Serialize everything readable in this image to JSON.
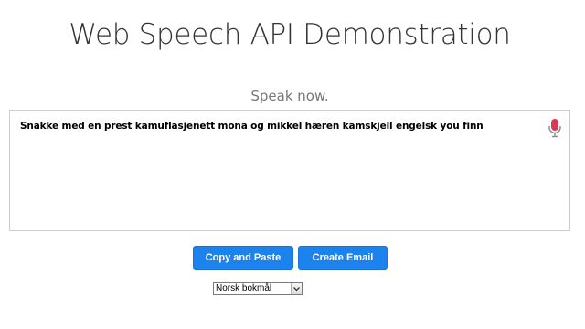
{
  "header": {
    "title_part1": "Web Speech API",
    "title_part2": "Demonstration"
  },
  "status": {
    "info_text": "Speak now."
  },
  "results": {
    "transcript": "Snakke med en prest kamuflasjenett mona og mikkel hæren kamskjell engelsk you finn",
    "mic_icon": "microphone-icon",
    "mic_color": "#d93a56"
  },
  "actions": {
    "copy_label": "Copy and Paste",
    "email_label": "Create Email",
    "button_color": "#1c82ee"
  },
  "language": {
    "selected": "Norsk bokmål",
    "icon": "chevron-down-icon"
  }
}
